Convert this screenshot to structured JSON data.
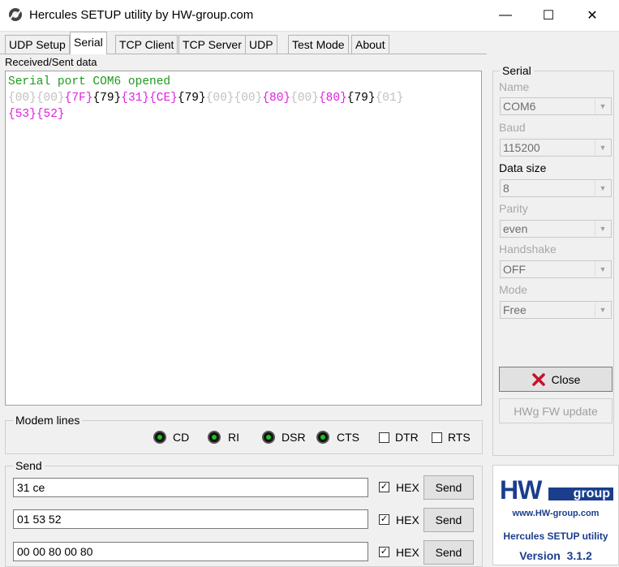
{
  "window": {
    "title": "Hercules SETUP utility by HW-group.com",
    "minimize": "—",
    "maximize": "☐",
    "close": "✕"
  },
  "tabs": [
    "UDP Setup",
    "Serial",
    "TCP Client",
    "TCP Server",
    "UDP",
    "Test Mode",
    "About"
  ],
  "received": {
    "label": "Received/Sent data",
    "line1": "Serial port COM6 opened",
    "bytes_line2": [
      {
        "t": "{00}",
        "c": "gray"
      },
      {
        "t": "{00}",
        "c": "gray"
      },
      {
        "t": "{7F}",
        "c": "mag"
      },
      {
        "t": "{79}",
        "c": "blk"
      },
      {
        "t": "{31}",
        "c": "mag"
      },
      {
        "t": "{CE}",
        "c": "mag"
      },
      {
        "t": "{79}",
        "c": "blk"
      },
      {
        "t": "{00}",
        "c": "gray"
      },
      {
        "t": "{00}",
        "c": "gray"
      },
      {
        "t": "{80}",
        "c": "mag"
      },
      {
        "t": "{00}",
        "c": "gray"
      },
      {
        "t": "{80}",
        "c": "mag"
      },
      {
        "t": "{79}",
        "c": "blk"
      },
      {
        "t": "{01}",
        "c": "gray"
      }
    ],
    "bytes_line3": [
      {
        "t": "{53}",
        "c": "mag"
      },
      {
        "t": "{52}",
        "c": "mag"
      }
    ]
  },
  "serial": {
    "title": "Serial",
    "name_label": "Name",
    "name_value": "COM6",
    "baud_label": "Baud",
    "baud_value": "115200",
    "datasize_label": "Data size",
    "datasize_value": "8",
    "parity_label": "Parity",
    "parity_value": "even",
    "handshake_label": "Handshake",
    "handshake_value": "OFF",
    "mode_label": "Mode",
    "mode_value": "Free",
    "close_label": "Close",
    "fw_label": "HWg FW update"
  },
  "modem": {
    "title": "Modem lines",
    "cd": "CD",
    "ri": "RI",
    "dsr": "DSR",
    "cts": "CTS",
    "dtr": "DTR",
    "rts": "RTS"
  },
  "send": {
    "title": "Send",
    "rows": [
      {
        "value": "31 ce",
        "hex_label": "HEX",
        "button": "Send"
      },
      {
        "value": "01 53 52",
        "hex_label": "HEX",
        "button": "Send"
      },
      {
        "value": "00 00 80 00 80",
        "hex_label": "HEX",
        "button": "Send"
      }
    ]
  },
  "logo": {
    "hw": "HW",
    "group": "group",
    "url": "www.HW-group.com",
    "product": "Hercules SETUP utility",
    "version": "Version  3.1.2"
  },
  "colors": {
    "green_text": "#1e9a1e",
    "magenta_byte": "#e020e0",
    "gray_byte": "#c0c0c0",
    "logo_blue": "#1a3e8c",
    "close_red": "#c8102e"
  }
}
